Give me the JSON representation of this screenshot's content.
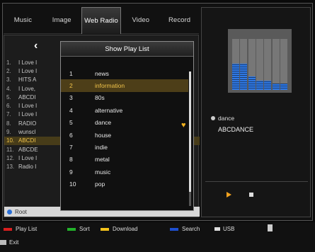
{
  "tabs": [
    "Music",
    "Image",
    "Web Radio",
    "Video",
    "Record"
  ],
  "active_tab": 2,
  "left_list": [
    {
      "n": "1.",
      "t": "I Love I"
    },
    {
      "n": "2.",
      "t": "I Love I"
    },
    {
      "n": "3.",
      "t": "HITS A"
    },
    {
      "n": "4.",
      "t": "I Love,"
    },
    {
      "n": "5.",
      "t": "ABCDI"
    },
    {
      "n": "6.",
      "t": "I Love I"
    },
    {
      "n": "7.",
      "t": "I Love I"
    },
    {
      "n": "8.",
      "t": "RADIO"
    },
    {
      "n": "9.",
      "t": "wunscl"
    },
    {
      "n": "10.",
      "t": "ABCDI"
    },
    {
      "n": "11.",
      "t": "ABCDE"
    },
    {
      "n": "12.",
      "t": "I Love I"
    },
    {
      "n": "13.",
      "t": "Radio I"
    }
  ],
  "left_selected": 9,
  "root_label": "Root",
  "popup": {
    "title": "Show Play List",
    "items": [
      {
        "n": "1",
        "t": "news"
      },
      {
        "n": "2",
        "t": "information"
      },
      {
        "n": "3",
        "t": "80s"
      },
      {
        "n": "4",
        "t": "alternative"
      },
      {
        "n": "5",
        "t": "dance"
      },
      {
        "n": "6",
        "t": "house"
      },
      {
        "n": "7",
        "t": "indie"
      },
      {
        "n": "8",
        "t": "metal"
      },
      {
        "n": "9",
        "t": "music"
      },
      {
        "n": "10",
        "t": "pop"
      }
    ],
    "selected": 1
  },
  "now_playing": {
    "genre": "dance",
    "station": "ABCDANCE"
  },
  "equalizer_levels": [
    0.52,
    0.52,
    0.26,
    0.18,
    0.18,
    0.12,
    0.12
  ],
  "footer": {
    "play_list": "Play List",
    "sort": "Sort",
    "download": "Download",
    "search": "Search",
    "usb": "USB",
    "exit": "Exit"
  },
  "colors": {
    "red": "#d91f1f",
    "green": "#22b22a",
    "yellow": "#f3c21b",
    "blue": "#1e4fd0",
    "accent": "#f0c34a"
  }
}
